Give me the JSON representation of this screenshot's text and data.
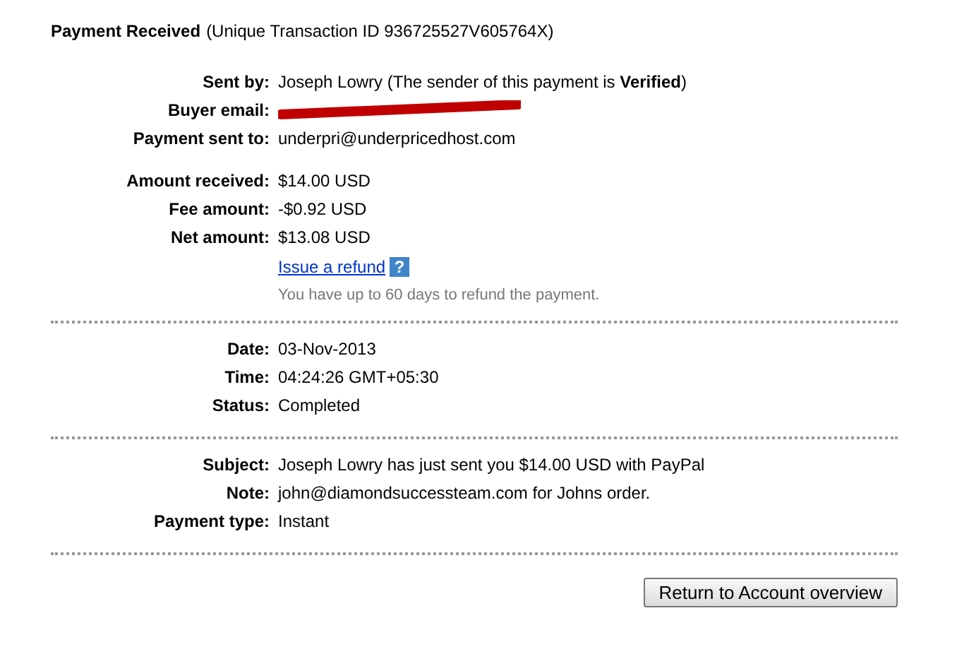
{
  "heading": {
    "title": "Payment Received",
    "subtitle": "(Unique Transaction ID 936725527V605764X)"
  },
  "sections": [
    {
      "groups": [
        {
          "rows": [
            {
              "label": "Sent by:",
              "value": "Joseph Lowry (The sender of this payment is **Verified**)"
            },
            {
              "label": "Buyer email:",
              "redacted": true
            },
            {
              "label": "Payment sent to:",
              "value": "underpri@underpricedhost.com"
            }
          ]
        },
        {
          "rows": [
            {
              "label": "Amount received:",
              "value": "$14.00 USD"
            },
            {
              "label": "Fee amount:",
              "value": "-$0.92 USD"
            },
            {
              "label": "Net amount:",
              "value": "$13.08 USD"
            }
          ]
        }
      ],
      "refund": {
        "link": "Issue a refund",
        "help": "?",
        "hint": "You have up to 60 days to refund the payment."
      }
    },
    {
      "groups": [
        {
          "rows": [
            {
              "label": "Date:",
              "value": "03-Nov-2013"
            },
            {
              "label": "Time:",
              "value": "04:24:26 GMT+05:30"
            },
            {
              "label": "Status:",
              "value": "Completed"
            }
          ]
        }
      ]
    },
    {
      "groups": [
        {
          "rows": [
            {
              "label": "Subject:",
              "value": "Joseph Lowry has just sent you $14.00 USD with PayPal"
            },
            {
              "label": "Note:",
              "value": "john@diamondsuccessteam.com for Johns order."
            },
            {
              "label": "Payment type:",
              "value": "Instant"
            }
          ]
        }
      ]
    }
  ],
  "button": "Return to Account overview"
}
